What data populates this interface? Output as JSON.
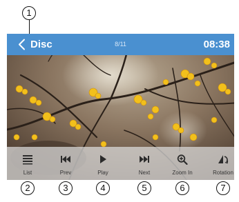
{
  "header": {
    "title": "Disc",
    "track": "8/11",
    "clock": "08:38"
  },
  "controls": [
    {
      "label": "List",
      "icon": "list-icon"
    },
    {
      "label": "Prev",
      "icon": "skip-previous-icon"
    },
    {
      "label": "Play",
      "icon": "play-icon"
    },
    {
      "label": "Next",
      "icon": "skip-next-icon"
    },
    {
      "label": "Zoom In",
      "icon": "zoom-in-icon"
    },
    {
      "label": "Rotation",
      "icon": "rotate-icon"
    }
  ],
  "callouts": [
    "1",
    "2",
    "3",
    "4",
    "5",
    "6",
    "7"
  ],
  "colors": {
    "header_bar": "#4a90d0",
    "control_bar": "#dedede",
    "callout_stroke": "#111111"
  }
}
